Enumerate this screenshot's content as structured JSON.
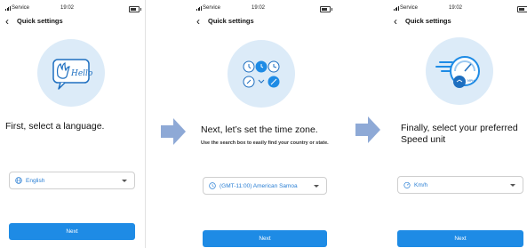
{
  "screens": [
    {
      "status": {
        "carrier": "Service",
        "time": "19:02"
      },
      "header": {
        "title": "Quick settings"
      },
      "heading": "First, select a language.",
      "select": {
        "value": "English",
        "icon": "globe-icon"
      },
      "illustration_text": "Hello",
      "next_label": "Next"
    },
    {
      "status": {
        "carrier": "Service",
        "time": "19:02"
      },
      "header": {
        "title": "Quick settings"
      },
      "heading": "Next, let’s set the time zone.",
      "subtext": "Use the search box to easily find your country or state.",
      "select": {
        "value": "(GMT-11:00) American Samoa",
        "icon": "clock-icon"
      },
      "next_label": "Next"
    },
    {
      "status": {
        "carrier": "Service",
        "time": "19:02"
      },
      "header": {
        "title": "Quick settings"
      },
      "heading": "Finally, select your preferred Speed unit",
      "select": {
        "value": "Km/h",
        "icon": "speedometer-icon"
      },
      "illustration_text": "MPH",
      "next_label": "Next"
    }
  ],
  "colors": {
    "accent": "#1e8be5",
    "illustration_bg": "#dcebf8",
    "arrow": "#8ea9d6"
  }
}
